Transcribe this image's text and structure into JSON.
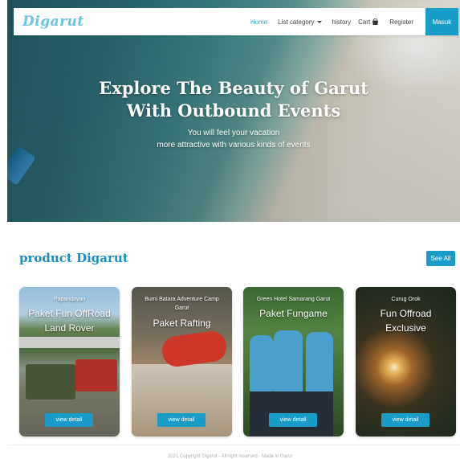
{
  "navbar": {
    "brand": "Digarut",
    "links": {
      "home": "Home",
      "list_category": "List category",
      "history": "history",
      "cart": "Cart",
      "register": "Register"
    },
    "login_button": "Masuk"
  },
  "hero": {
    "title_line1": "Explore The Beauty of Garut",
    "title_line2": "With Outbound Events",
    "subtitle_line1": "You will feel your vacation",
    "subtitle_line2": "more attractive with various kinds of events"
  },
  "products": {
    "heading": "product Digarut",
    "see_all_label": "See All",
    "detail_label": "view detail",
    "items": [
      {
        "location": "Papandayan",
        "title": "Paket Fun OffRoad Land Rover"
      },
      {
        "location": "Bumi Batara Adventure Camp Garut",
        "title": "Paket Rafting"
      },
      {
        "location": "Green Hotel Samarang Garut",
        "title": "Paket Fungame"
      },
      {
        "location": "Curug Orok",
        "title": "Fun Offroad Exclusive"
      }
    ]
  },
  "footer": {
    "text": "2021 Copyright Digarut - All right reserved - Made in Garut"
  },
  "colors": {
    "accent": "#1a9cc9",
    "brand": "#6fc3e0",
    "heading": "#1a8fbd"
  }
}
